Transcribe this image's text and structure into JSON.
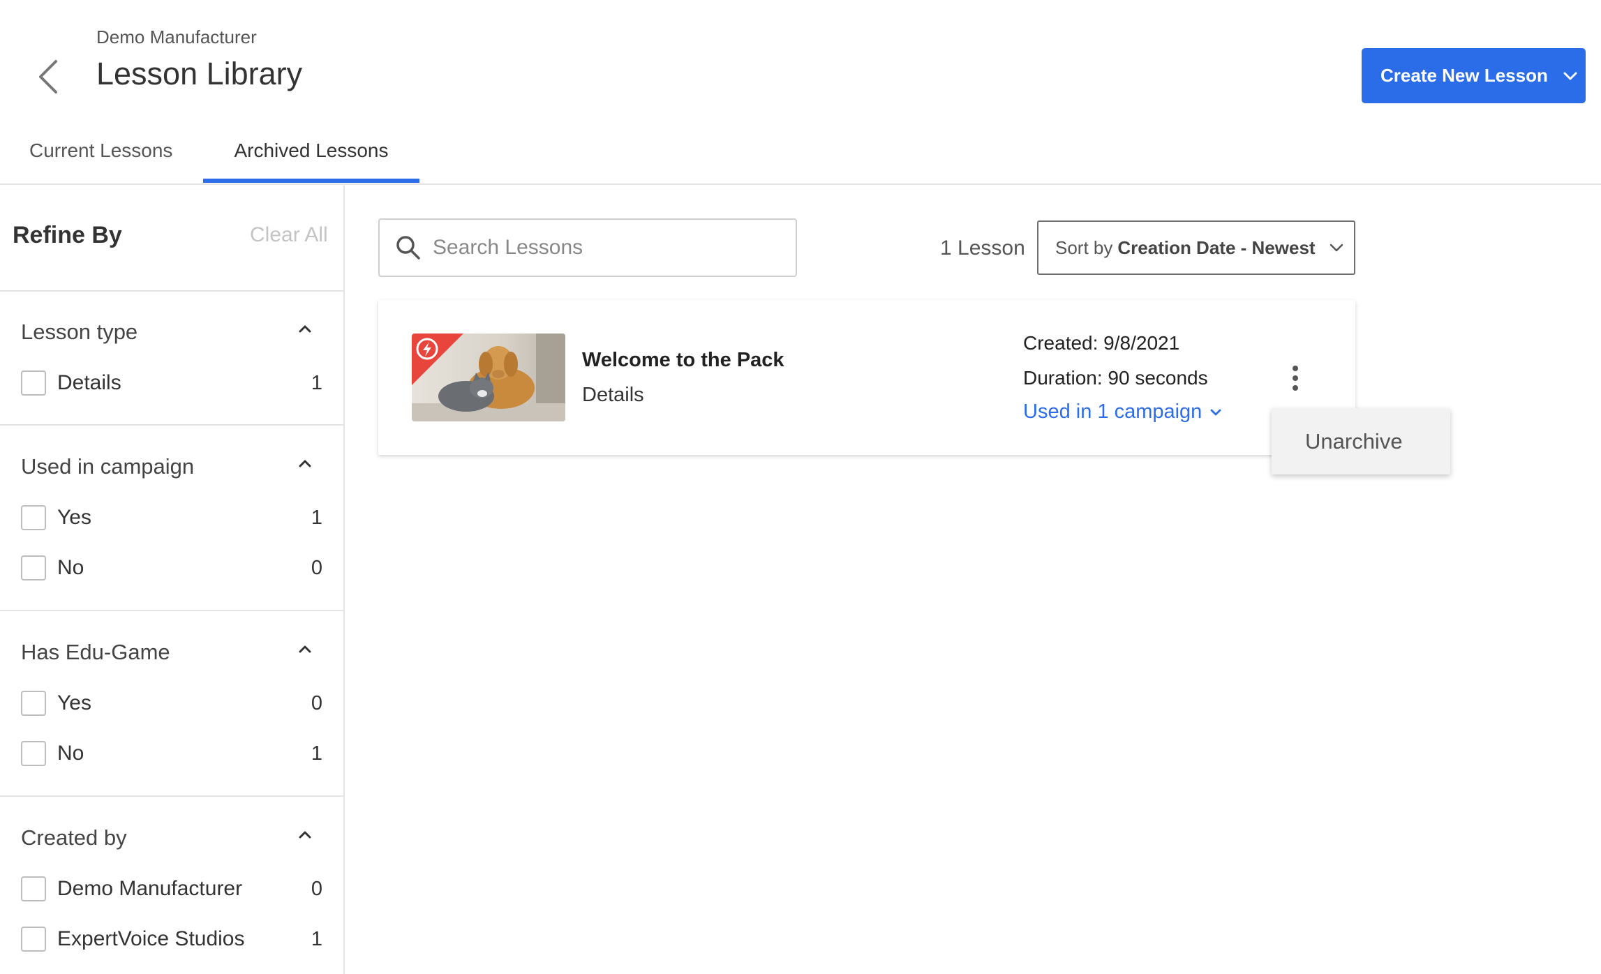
{
  "header": {
    "company": "Demo Manufacturer",
    "title": "Lesson Library",
    "create_button": "Create New Lesson"
  },
  "tabs": [
    {
      "label": "Current Lessons",
      "active": false
    },
    {
      "label": "Archived Lessons",
      "active": true
    }
  ],
  "sidebar": {
    "title": "Refine By",
    "clear_all": "Clear All",
    "groups": [
      {
        "title": "Lesson type",
        "options": [
          {
            "label": "Details",
            "count": "1",
            "checked": false
          }
        ]
      },
      {
        "title": "Used in campaign",
        "options": [
          {
            "label": "Yes",
            "count": "1",
            "checked": false
          },
          {
            "label": "No",
            "count": "0",
            "checked": false
          }
        ]
      },
      {
        "title": "Has Edu-Game",
        "options": [
          {
            "label": "Yes",
            "count": "0",
            "checked": false
          },
          {
            "label": "No",
            "count": "1",
            "checked": false
          }
        ]
      },
      {
        "title": "Created by",
        "options": [
          {
            "label": "Demo Manufacturer",
            "count": "0",
            "checked": false
          },
          {
            "label": "ExpertVoice Studios",
            "count": "1",
            "checked": false
          }
        ]
      }
    ]
  },
  "search": {
    "placeholder": "Search Lessons",
    "value": ""
  },
  "results": {
    "count_label": "1 Lesson",
    "sort_prefix": "Sort by",
    "sort_value": "Creation Date - Newest"
  },
  "lesson": {
    "name": "Welcome to the Pack",
    "type": "Details",
    "created": "Created: 9/8/2021",
    "duration": "Duration: 90 seconds",
    "used_in": "Used in 1 campaign"
  },
  "menu": {
    "unarchive": "Unarchive"
  },
  "colors": {
    "accent": "#2b6de8",
    "badge": "#e8453c"
  }
}
